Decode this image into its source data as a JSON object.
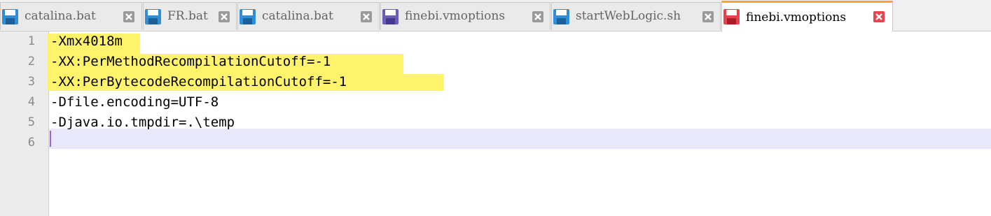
{
  "tabs": [
    {
      "label": "catalina.bat",
      "icon": "save-disk-icon",
      "icon_color": "#2f8fd6",
      "active": false
    },
    {
      "label": "FR.bat",
      "icon": "save-disk-icon",
      "icon_color": "#2f8fd6",
      "active": false
    },
    {
      "label": "catalina.bat",
      "icon": "save-disk-icon",
      "icon_color": "#2f8fd6",
      "active": false
    },
    {
      "label": "finebi.vmoptions",
      "icon": "save-disk-icon",
      "icon_color": "#6a5fb5",
      "active": false
    },
    {
      "label": "startWebLogic.sh",
      "icon": "save-disk-icon",
      "icon_color": "#2f8fd6",
      "active": false
    },
    {
      "label": "finebi.vmoptions",
      "icon": "save-disk-icon",
      "icon_color": "#e8424f",
      "active": true
    }
  ],
  "editor": {
    "line_numbers": [
      "1",
      "2",
      "3",
      "4",
      "5",
      "6"
    ],
    "lines": [
      "-Xmx4018m",
      "-XX:PerMethodRecompilationCutoff=-1",
      "-XX:PerBytecodeRecompilationCutoff=-1",
      "-Dfile.encoding=UTF-8",
      "-Djava.io.tmpdir=.\\temp",
      ""
    ],
    "highlighted_lines": [
      1,
      2,
      3
    ],
    "current_line": 6
  },
  "colors": {
    "highlight": "#fff36b",
    "current_line": "#e8e8fa",
    "active_tab_accent": "#f5a33a",
    "close_inactive": "#9a9a9a",
    "close_active": "#e8424f"
  }
}
